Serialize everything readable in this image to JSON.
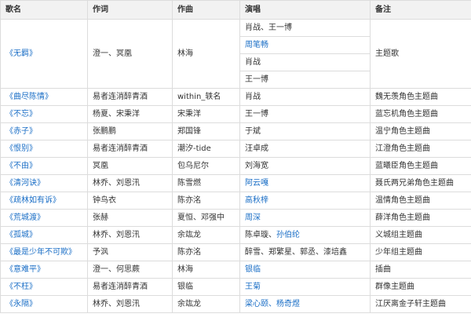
{
  "headers": [
    "歌名",
    "作词",
    "作曲",
    "演唱",
    "备注"
  ],
  "wuji": {
    "title": "《无羁》",
    "lyricist": "澄一、冥凰",
    "composer": "林海",
    "singers": [
      "肖战、王一博",
      "周笔畅",
      "肖战",
      "王一博"
    ],
    "note": "主题歌"
  },
  "rows": [
    {
      "title": "《曲尽陈情》",
      "lyricist": "易者连消醉青酒",
      "composer": "within_轶名",
      "singer": "肖战",
      "note": "魏无羡角色主题曲"
    },
    {
      "title": "《不忘》",
      "lyricist": "杨夏、宋秉洋",
      "composer": "宋秉洋",
      "singer": "王一博",
      "note": "蓝忘机角色主题曲"
    },
    {
      "title": "《赤子》",
      "lyricist": "张鹏鹏",
      "composer": "郑国锋",
      "singer": "于斌",
      "note": "温宁角色主题曲"
    },
    {
      "title": "《恨别》",
      "lyricist": "易者连消醉青酒",
      "composer": "潮汐-tide",
      "singer": "汪卓成",
      "note": "江澄角色主题曲"
    },
    {
      "title": "《不由》",
      "lyricist": "冥凰",
      "composer": "包乌尼尔",
      "singer": "刘海宽",
      "note": "蓝曦臣角色主题曲"
    },
    {
      "title": "《清河诀》",
      "lyricist": "林乔、刘恩汛",
      "composer": "陈雪燃",
      "singer": "阿云嘎",
      "note": "聂氏两兄弟角色主题曲"
    },
    {
      "title": "《疏林如有诉》",
      "lyricist": "钟鸟衣",
      "composer": "陈亦洺",
      "singer": "高秋梓",
      "note": "温情角色主题曲"
    },
    {
      "title": "《荒城渡》",
      "lyricist": "张赫",
      "composer": "夏恒、邓强中",
      "singer": "周深",
      "note": "薛洋角色主题曲"
    },
    {
      "title": "《孤城》",
      "lyricist": "林乔、刘恩汛",
      "composer": "余竑龙",
      "singer": "陈卓璇、孙伯纶",
      "note": "义城组主题曲"
    },
    {
      "title": "《最是少年不可欺》",
      "lyricist": "予沨",
      "composer": "陈亦洺",
      "singer": "醉雪、郑繁星、郭丞、漆培鑫",
      "note": "少年组主题曲"
    },
    {
      "title": "《意难平》",
      "lyricist": "澄一、何思蕨",
      "composer": "林海",
      "singer": "银临",
      "note": "插曲"
    },
    {
      "title": "《不枉》",
      "lyricist": "易者连消醉青酒",
      "composer": "银临",
      "singer": "王菊",
      "note": "群像主题曲"
    },
    {
      "title": "《永隔》",
      "lyricist": "林乔、刘恩汛",
      "composer": "余竑龙",
      "singer": "梁心颐、杨奇煜",
      "note": "江厌离金子轩主题曲"
    }
  ],
  "colors": {
    "link": "#1a6ec6",
    "text": "#333333",
    "header_bg": "#f2f2f2",
    "border": "#dcdcdc"
  }
}
